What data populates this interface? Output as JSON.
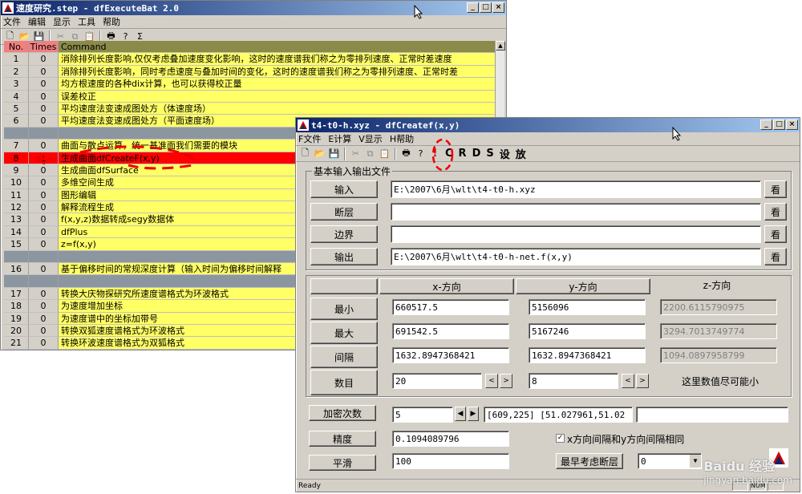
{
  "win1": {
    "title": "速度研究.step - dfExecuteBat 2.0",
    "menu": [
      "文件",
      "编辑",
      "显示",
      "工具",
      "帮助"
    ],
    "headers": {
      "no": "No.",
      "times": "Times",
      "command": "Command"
    },
    "rows": [
      {
        "no": "1",
        "times": "0",
        "cmd": "消除排列长度影响,仅仅考虑叠加速度变化影响，这时的速度谱我们称之为零排列速度、正常时差速度",
        "style": "yellow"
      },
      {
        "no": "2",
        "times": "0",
        "cmd": "消除排列长度影响，同时考虑速度与叠加时间的变化，这时的速度谱我们称之为零排列速度、正常时差",
        "style": "yellow"
      },
      {
        "no": "3",
        "times": "0",
        "cmd": "均方根速度的各种dix计算，也可以获得校正量",
        "style": "yellow"
      },
      {
        "no": "4",
        "times": "0",
        "cmd": "误差校正",
        "style": "yellow"
      },
      {
        "no": "5",
        "times": "0",
        "cmd": "平均速度法变速成图处方（体速度场）",
        "style": "yellow"
      },
      {
        "no": "6",
        "times": "0",
        "cmd": "平均速度法变速成图处方（平面速度场）",
        "style": "yellow"
      },
      {
        "no": "",
        "times": "",
        "cmd": "",
        "style": "sep"
      },
      {
        "no": "7",
        "times": "0",
        "cmd": "曲面与散点运算，统一基准面我们需要的模块",
        "style": "yellow"
      },
      {
        "no": "8",
        "times": "1",
        "cmd": "生成曲面dfCreateF(x,y)",
        "style": "red"
      },
      {
        "no": "9",
        "times": "0",
        "cmd": "生成曲面dfSurface",
        "style": "yellow"
      },
      {
        "no": "10",
        "times": "0",
        "cmd": "多维空间生成",
        "style": "yellow"
      },
      {
        "no": "11",
        "times": "0",
        "cmd": "图形编辑",
        "style": "yellow"
      },
      {
        "no": "12",
        "times": "0",
        "cmd": "解释流程生成",
        "style": "yellow"
      },
      {
        "no": "13",
        "times": "0",
        "cmd": "f(x,y,z)数据转成segy数据体",
        "style": "yellow"
      },
      {
        "no": "14",
        "times": "0",
        "cmd": "dfPlus",
        "style": "yellow"
      },
      {
        "no": "15",
        "times": "0",
        "cmd": "z=f(x,y)",
        "style": "yellow"
      },
      {
        "no": "",
        "times": "",
        "cmd": "",
        "style": "sep"
      },
      {
        "no": "16",
        "times": "0",
        "cmd": "基于偏移时间的常规深度计算（输入时间为偏移时间解释",
        "style": "yellow"
      },
      {
        "no": "",
        "times": "",
        "cmd": "",
        "style": "sep"
      },
      {
        "no": "17",
        "times": "0",
        "cmd": "转换大庆物探研究所速度谱格式为环波格式",
        "style": "yellow"
      },
      {
        "no": "18",
        "times": "0",
        "cmd": "为速度增加坐标",
        "style": "yellow"
      },
      {
        "no": "19",
        "times": "0",
        "cmd": "为速度谱中的坐标加带号",
        "style": "yellow"
      },
      {
        "no": "20",
        "times": "0",
        "cmd": "转换双狐速度谱格式为环波格式",
        "style": "yellow"
      },
      {
        "no": "21",
        "times": "0",
        "cmd": "转换环波速度谱格式为双狐格式",
        "style": "yellow"
      }
    ]
  },
  "win2": {
    "title": "t4-t0-h.xyz - dfCreatef(x,y)",
    "menu": [
      "F文件",
      "E计算",
      "V显示",
      "H帮助"
    ],
    "toolbar_text": [
      "C",
      "R",
      "D",
      "S",
      "设",
      "放"
    ],
    "toolbar_bang": "!",
    "io_group_title": "基本输入输出文件",
    "io": [
      {
        "label": "输入",
        "value": "E:\\2007\\6月\\wlt\\t4-t0-h.xyz"
      },
      {
        "label": "断层",
        "value": ""
      },
      {
        "label": "边界",
        "value": ""
      },
      {
        "label": "输出",
        "value": "E:\\2007\\6月\\wlt\\t4-t0-h-net.f(x,y)"
      }
    ],
    "view_label": "看",
    "col_x": "x-方向",
    "col_y": "y-方向",
    "col_z": "z-方向",
    "rows": [
      {
        "label": "最小",
        "x": "660517.5",
        "y": "5156096",
        "z": "2200.6115790975"
      },
      {
        "label": "最大",
        "x": "691542.5",
        "y": "5167246",
        "z": "3294.7013749774"
      },
      {
        "label": "间隔",
        "x": "1632.8947368421",
        "y": "1632.8947368421",
        "z": "1094.0897958799"
      }
    ],
    "count_label": "数目",
    "count_x": "20",
    "count_y": "8",
    "count_note": "这里数值尽可能小",
    "densify_label": "加密次数",
    "densify_value": "5",
    "range_value": "[609,225]  [51.027961,51.02",
    "precision_label": "精度",
    "precision_value": "0.1094089796",
    "smooth_label": "平滑",
    "smooth_value": "100",
    "check_label": "x方向间隔和y方向间隔相同",
    "fault_label": "最早考虑断层",
    "fault_value": "0",
    "status": "Ready",
    "status_num": "NUM"
  },
  "watermark": {
    "main": "Baidu 经验",
    "sub": "jingyan.baidu.com"
  }
}
